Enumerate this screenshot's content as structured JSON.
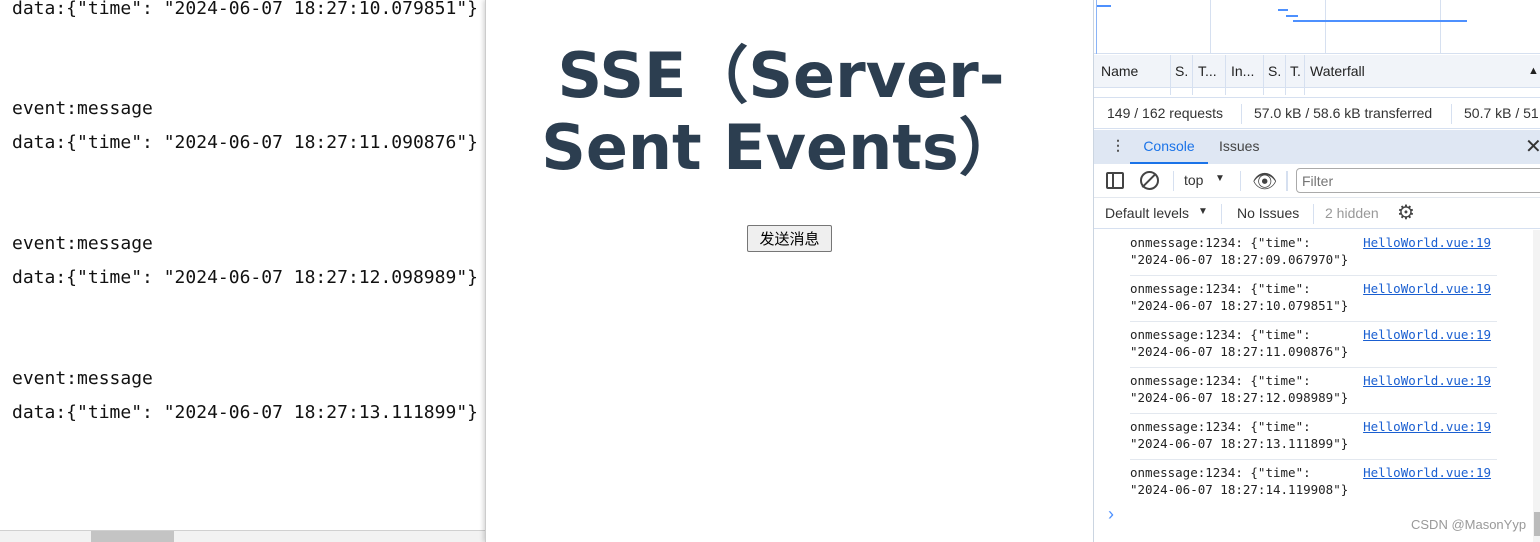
{
  "left_output": {
    "lines": [
      "data:{\"time\": \"2024-06-07 18:27:10.079851\"}",
      "event:message",
      "data:{\"time\": \"2024-06-07 18:27:11.090876\"}",
      "event:message",
      "data:{\"time\": \"2024-06-07 18:27:12.098989\"}",
      "event:message",
      "data:{\"time\": \"2024-06-07 18:27:13.111899\"}"
    ]
  },
  "page": {
    "title": "SSE（Server-Sent Events）",
    "send_button": "发送消息"
  },
  "devtools": {
    "network": {
      "columns": [
        "Name",
        "S.",
        "T...",
        "In...",
        "S.",
        "T.",
        "Waterfall"
      ],
      "requests": "149 / 162 requests",
      "transferred": "57.0 kB / 58.6 kB transferred",
      "resources": "50.7 kB / 51"
    },
    "drawer_tabs": [
      "Console",
      "Issues"
    ],
    "active_tab": "Console",
    "context": "top",
    "filter_placeholder": "Filter",
    "levels": "Default levels",
    "issues": "No Issues",
    "hidden": "2 hidden",
    "messages": [
      {
        "text1": "onmessage:1234: {\"time\":",
        "text2": "\"2024-06-07 18:27:09.067970\"}",
        "source": "HelloWorld.vue:19"
      },
      {
        "text1": "onmessage:1234: {\"time\":",
        "text2": "\"2024-06-07 18:27:10.079851\"}",
        "source": "HelloWorld.vue:19"
      },
      {
        "text1": "onmessage:1234: {\"time\":",
        "text2": "\"2024-06-07 18:27:11.090876\"}",
        "source": "HelloWorld.vue:19"
      },
      {
        "text1": "onmessage:1234: {\"time\":",
        "text2": "\"2024-06-07 18:27:12.098989\"}",
        "source": "HelloWorld.vue:19"
      },
      {
        "text1": "onmessage:1234: {\"time\":",
        "text2": "\"2024-06-07 18:27:13.111899\"}",
        "source": "HelloWorld.vue:19"
      },
      {
        "text1": "onmessage:1234: {\"time\":",
        "text2": "\"2024-06-07 18:27:14.119908\"}",
        "source": "HelloWorld.vue:19"
      }
    ],
    "prompt": "›",
    "watermark": "CSDN @MasonYyp",
    "accent": "#1a73e8"
  }
}
